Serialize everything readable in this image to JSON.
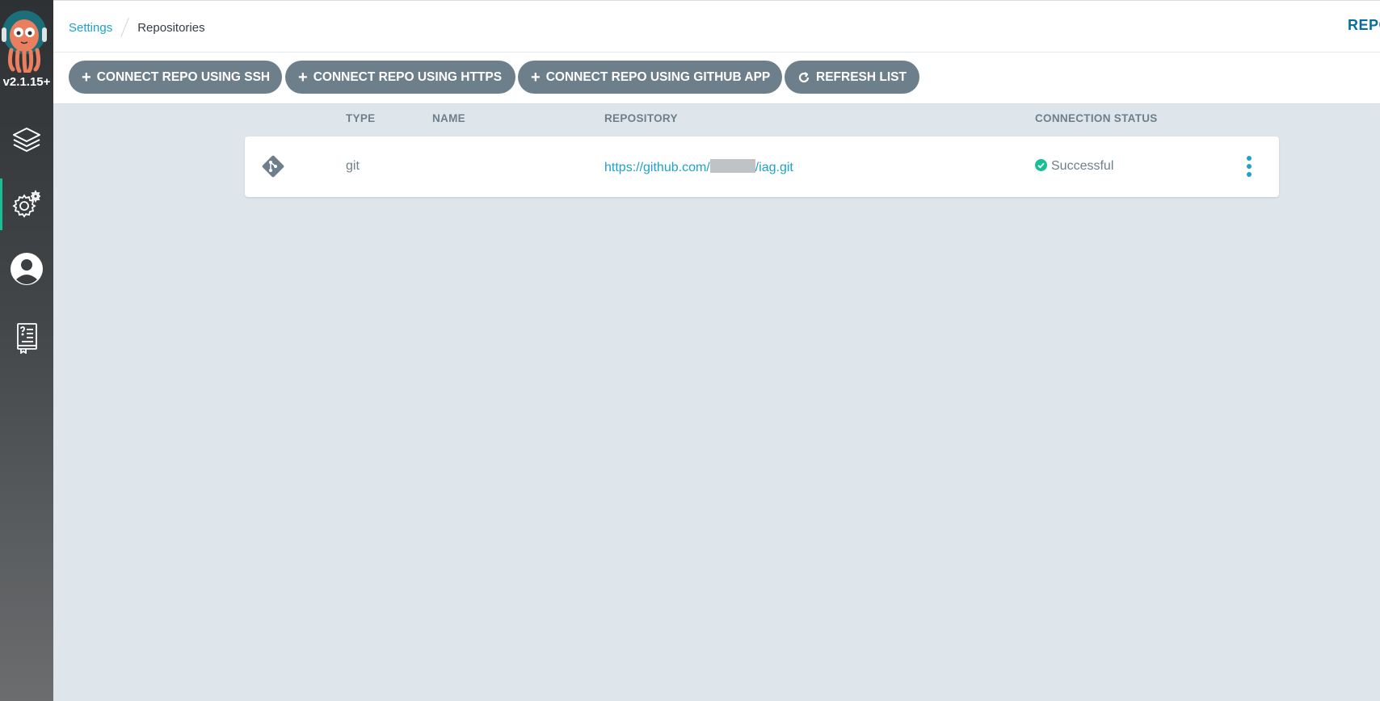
{
  "sidebar": {
    "version": "v2.1.15+",
    "nav": [
      {
        "name": "applications",
        "icon": "layers-icon"
      },
      {
        "name": "settings",
        "icon": "gear-icon",
        "active": true
      },
      {
        "name": "user-info",
        "icon": "user-icon"
      },
      {
        "name": "documentation",
        "icon": "help-book-icon"
      }
    ]
  },
  "breadcrumb": {
    "parent": "Settings",
    "current": "Repositories"
  },
  "page_title": "REPOSITORIES",
  "toolbar": {
    "ssh_label": "CONNECT REPO USING SSH",
    "https_label": "CONNECT REPO USING HTTPS",
    "github_app_label": "CONNECT REPO USING GITHUB APP",
    "refresh_label": "REFRESH LIST"
  },
  "table": {
    "headers": {
      "type": "TYPE",
      "name": "NAME",
      "repository": "REPOSITORY",
      "status": "CONNECTION STATUS"
    },
    "rows": [
      {
        "icon": "git-icon",
        "type": "git",
        "name": "",
        "repo_prefix": "https://github.com/",
        "repo_suffix": "/iag.git",
        "status": "Successful"
      }
    ]
  },
  "colors": {
    "accent": "#1ea2c9",
    "button": "#6d7f8b",
    "success": "#18be94",
    "background": "#dee6eb"
  }
}
